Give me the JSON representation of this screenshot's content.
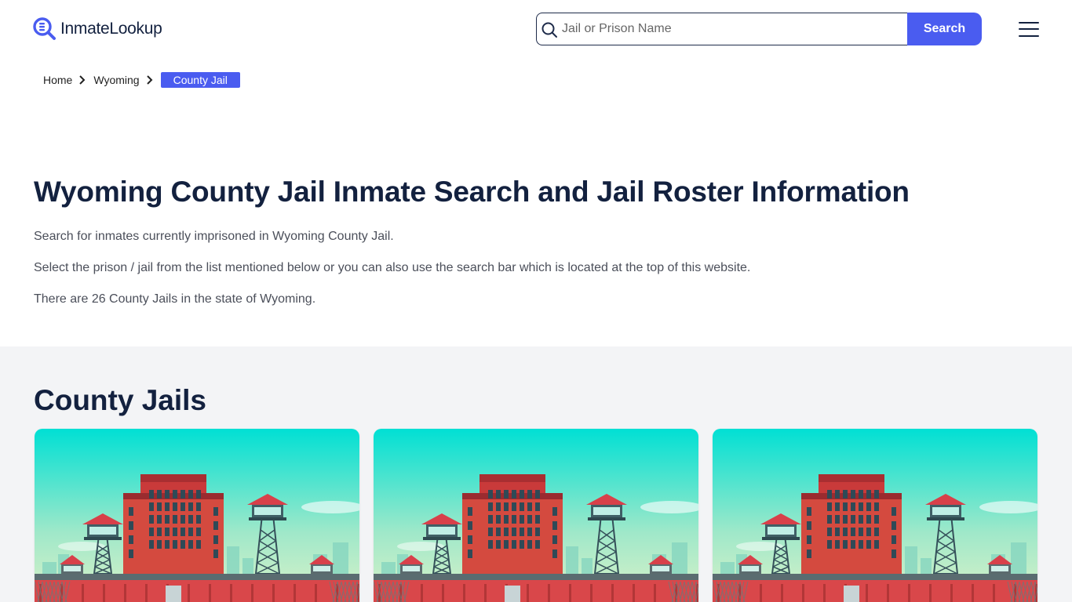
{
  "header": {
    "logo_text": "InmateLookup",
    "search": {
      "placeholder": "Jail or Prison Name",
      "button_label": "Search"
    }
  },
  "breadcrumb": {
    "items": [
      "Home",
      "Wyoming"
    ],
    "current": "County Jail"
  },
  "intro": {
    "title": "Wyoming County Jail Inmate Search and Jail Roster Information",
    "paragraphs": [
      "Search for inmates currently imprisoned in Wyoming County Jail.",
      "Select the prison / jail from the list mentioned below or you can also use the search bar which is located at the top of this website.",
      "There are 26 County Jails in the state of Wyoming."
    ]
  },
  "county_jails": {
    "title": "County Jails"
  },
  "colors": {
    "accent": "#4a5cf0",
    "heading": "#13213f",
    "section_bg": "#f3f4f6"
  },
  "icons": [
    "logo-icon",
    "search-icon",
    "chevron-right-icon",
    "hamburger-menu-icon"
  ]
}
